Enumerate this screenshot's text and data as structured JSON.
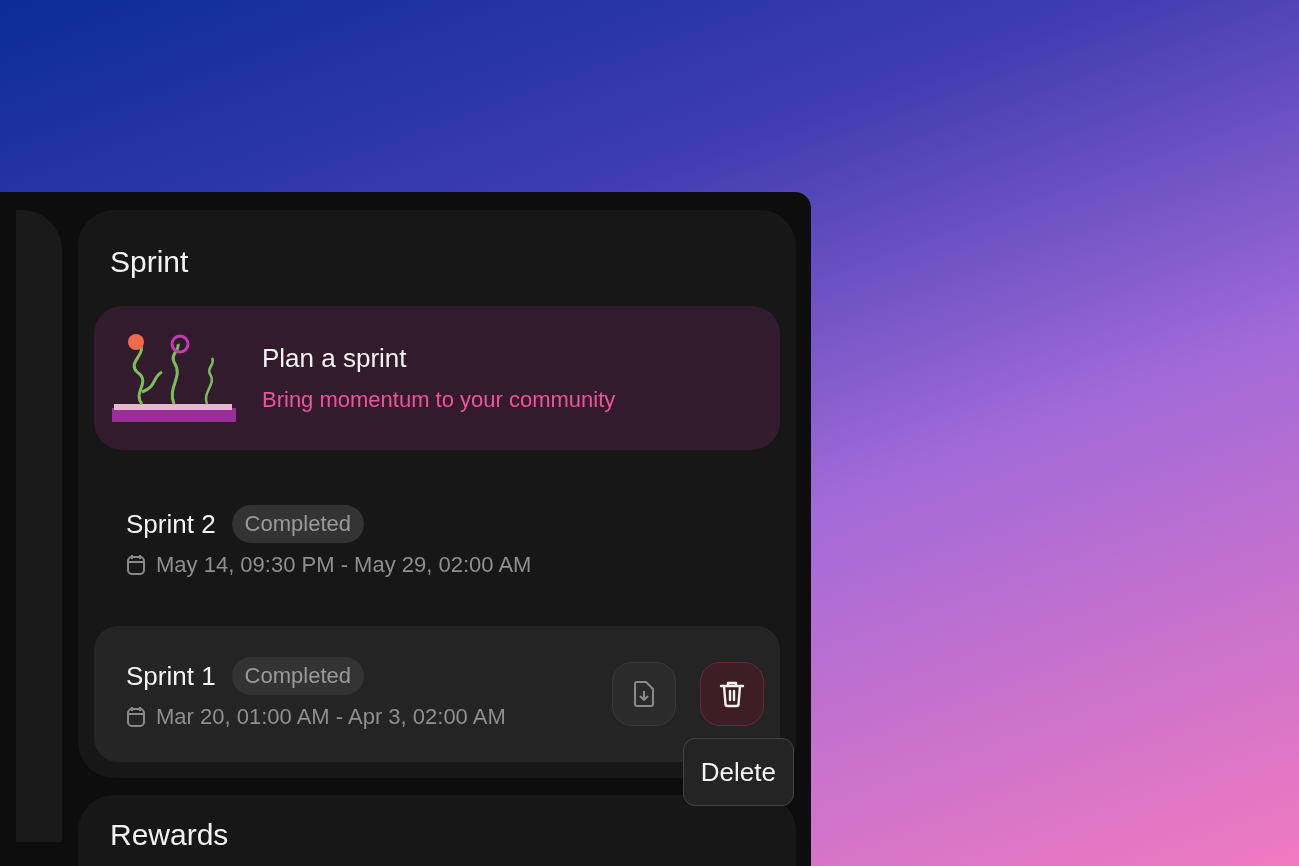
{
  "sprint_panel": {
    "title": "Sprint",
    "promo": {
      "title": "Plan a sprint",
      "subtitle": "Bring momentum to your community"
    },
    "sprints": [
      {
        "name": "Sprint 2",
        "status": "Completed",
        "dates": "May 14, 09:30 PM - May 29, 02:00 AM",
        "hovered": false
      },
      {
        "name": "Sprint 1",
        "status": "Completed",
        "dates": "Mar 20, 01:00 AM - Apr 3, 02:00 AM",
        "hovered": true
      }
    ],
    "tooltip": "Delete"
  },
  "rewards_panel": {
    "title": "Rewards"
  }
}
